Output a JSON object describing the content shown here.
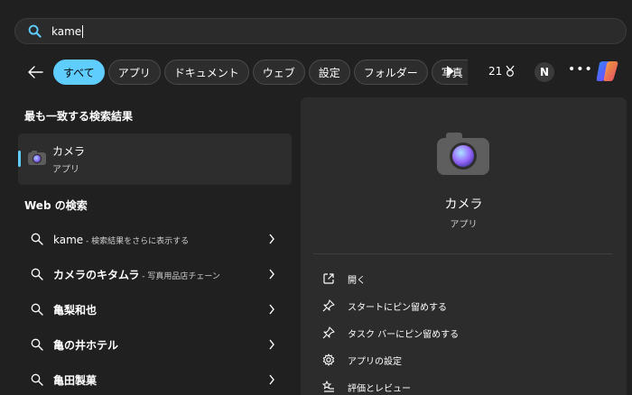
{
  "search": {
    "query": "kame"
  },
  "filters": {
    "chips": [
      "すべて",
      "アプリ",
      "ドキュメント",
      "ウェブ",
      "設定",
      "フォルダー",
      "写真"
    ],
    "points": "21",
    "avatar_initial": "N"
  },
  "best_match": {
    "heading": "最も一致する検索結果",
    "name": "カメラ",
    "type": "アプリ"
  },
  "web": {
    "heading": "Web の検索",
    "results": [
      {
        "term": "kame",
        "sub": " - 検索結果をさらに表示する"
      },
      {
        "term": "カメラのキタムラ",
        "sub": " - 写真用品店チェーン"
      },
      {
        "term": "亀梨和也",
        "sub": ""
      },
      {
        "term": "亀の井ホテル",
        "sub": ""
      },
      {
        "term": "亀田製菓",
        "sub": ""
      }
    ]
  },
  "details": {
    "title": "カメラ",
    "type": "アプリ",
    "actions": [
      {
        "icon": "open-icon",
        "label": "開く"
      },
      {
        "icon": "pin-icon",
        "label": "スタートにピン留めする"
      },
      {
        "icon": "pin-icon",
        "label": "タスク バーにピン留めする"
      },
      {
        "icon": "gear-icon",
        "label": "アプリの設定"
      },
      {
        "icon": "rate-review-icon",
        "label": "評価とレビュー"
      }
    ]
  },
  "colors": {
    "accent": "#60cdff",
    "background": "#202020",
    "panel": "#2c2c2c"
  }
}
